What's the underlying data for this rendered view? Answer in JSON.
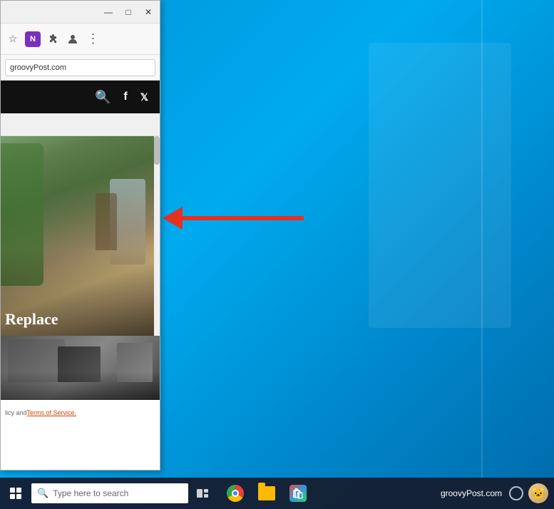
{
  "desktop": {
    "background_color": "#0095d9"
  },
  "browser": {
    "title": "groovyPost.com",
    "title_bar": {
      "minimize_label": "—",
      "maximize_label": "□",
      "close_label": "✕"
    },
    "address_bar": {
      "url": "groovyPost.com"
    },
    "toolbar": {
      "bookmark_icon": "☆",
      "extension_icon": "N",
      "puzzle_icon": "🧩",
      "account_icon": "👤",
      "menu_icon": "⋮"
    },
    "site": {
      "search_icon": "🔍",
      "facebook_icon": "f",
      "twitter_icon": "𝕏",
      "hero_text": "Replace",
      "search_placeholder": "",
      "footer_text": "icy and ",
      "footer_link_text": "Terms of Service.",
      "footer_prefix": "l"
    }
  },
  "arrow": {
    "color": "#e63020"
  },
  "taskbar": {
    "search_placeholder": "Type here to search",
    "domain": "groovyPost.com",
    "apps": [
      {
        "name": "Chrome",
        "type": "chrome"
      },
      {
        "name": "File Explorer",
        "type": "file-explorer"
      },
      {
        "name": "Microsoft Store",
        "type": "store"
      },
      {
        "name": "Avatar",
        "type": "avatar"
      }
    ]
  }
}
